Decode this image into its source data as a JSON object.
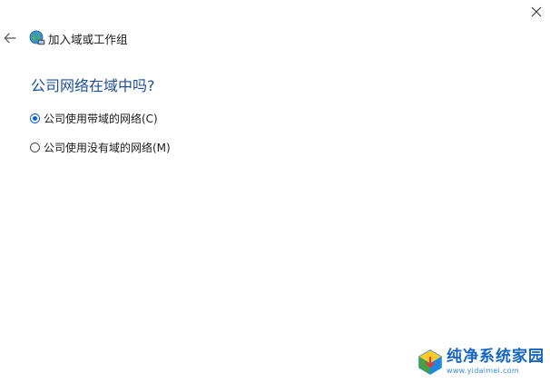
{
  "window": {
    "title": "加入域或工作组",
    "close_icon": "close-icon",
    "back_icon": "back-arrow-icon",
    "app_icon": "network-globe-icon"
  },
  "question": "公司网络在域中吗?",
  "options": [
    {
      "label": "公司使用带域的网络(C)",
      "selected": true
    },
    {
      "label": "公司使用没有域的网络(M)",
      "selected": false
    }
  ],
  "watermark": {
    "title": "纯净系统家园",
    "url": "www.yidaimei.com"
  },
  "colors": {
    "heading": "#1f4e96",
    "radio_accent": "#0b64c8",
    "watermark": "#1565c0"
  }
}
